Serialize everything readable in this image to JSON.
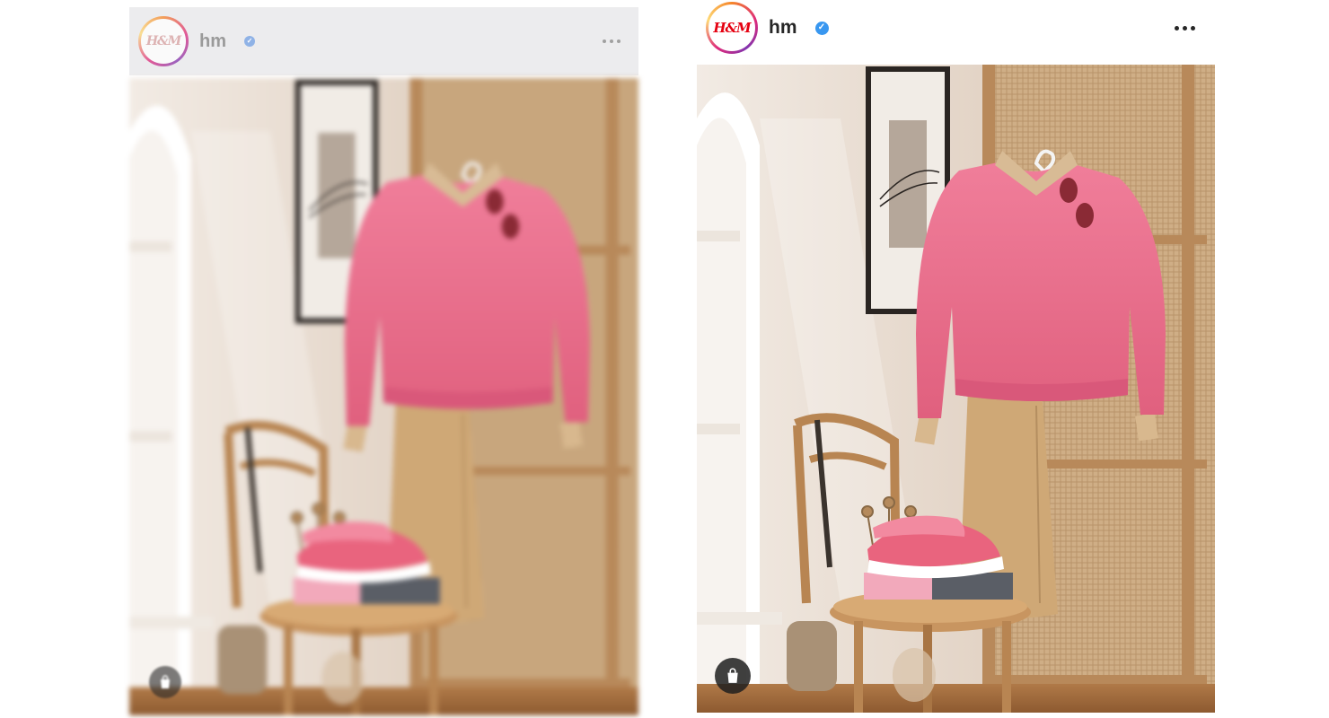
{
  "posts": [
    {
      "id": "blurred",
      "account": {
        "username": "hm",
        "logo_text": "H&M",
        "verified": true
      },
      "photo_alt": "",
      "shop_icon": "shopping-bag-icon"
    },
    {
      "id": "sharp",
      "account": {
        "username": "hm",
        "logo_text": "H&M",
        "verified": true
      },
      "photo_alt": "",
      "shop_icon": "shopping-bag-icon"
    }
  ],
  "colors": {
    "verified_badge": "#3897f0",
    "brand_red": "#e50010",
    "story_ring": [
      "#f58529",
      "#dd2a7b",
      "#8134af",
      "#feda77"
    ]
  }
}
